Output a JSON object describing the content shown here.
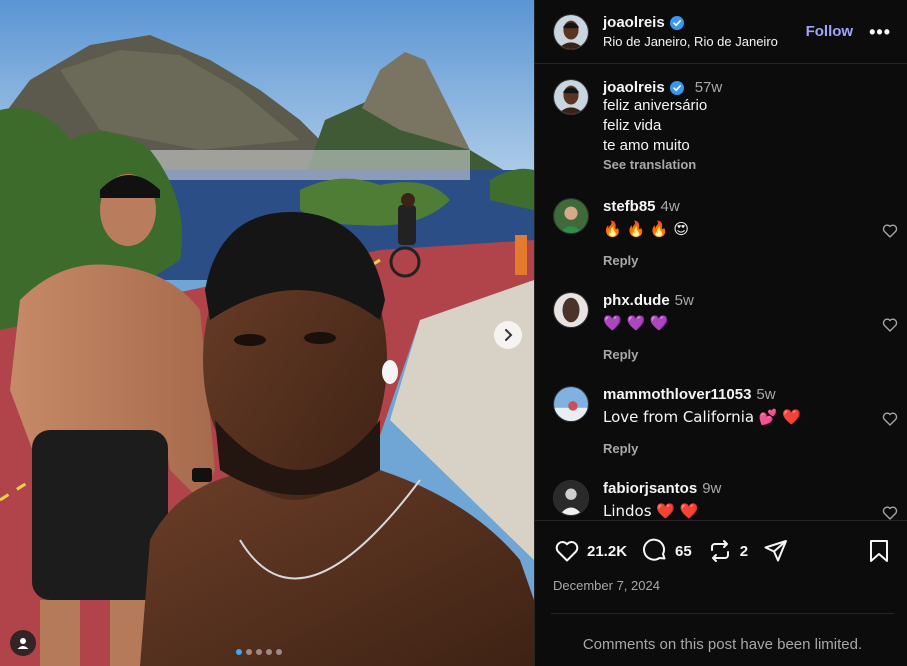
{
  "post": {
    "username": "joaolreis",
    "location": "Rio de Janeiro, Rio de Janeiro",
    "follow_label": "Follow",
    "more_label": "•••",
    "caption": {
      "username": "joaolreis",
      "time": "57w",
      "lines": [
        "feliz aniversário",
        "feliz vida",
        "te amo muito"
      ],
      "see_translation": "See translation"
    },
    "comments": [
      {
        "user": "stefb85",
        "time": "4w",
        "text": "🔥 🔥 🔥 😍",
        "reply": "Reply"
      },
      {
        "user": "phx.dude",
        "time": "5w",
        "text": "💜 💜 💜",
        "reply": "Reply"
      },
      {
        "user": "mammothlover11053",
        "time": "5w",
        "text": "Love from California 💕 ❤️",
        "reply": "Reply"
      },
      {
        "user": "fabiorjsantos",
        "time": "9w",
        "text": "Lindos ❤️ ❤️",
        "reply": ""
      }
    ],
    "likes": "21.2K",
    "comment_count": "65",
    "reposts": "2",
    "date": "December 7, 2024",
    "limited_notice": "Comments on this post have been limited.",
    "carousel": {
      "total": 5,
      "active": 1
    }
  },
  "colors": {
    "accent_follow": "#a1a4ff",
    "verified": "#3897f0",
    "background": "#0c0c0c",
    "muted_text": "#a8a8a8"
  },
  "icons": [
    "verified-badge-icon",
    "heart-icon",
    "comment-icon",
    "repost-icon",
    "share-icon",
    "bookmark-icon",
    "chevron-right-icon",
    "user-tag-icon"
  ]
}
